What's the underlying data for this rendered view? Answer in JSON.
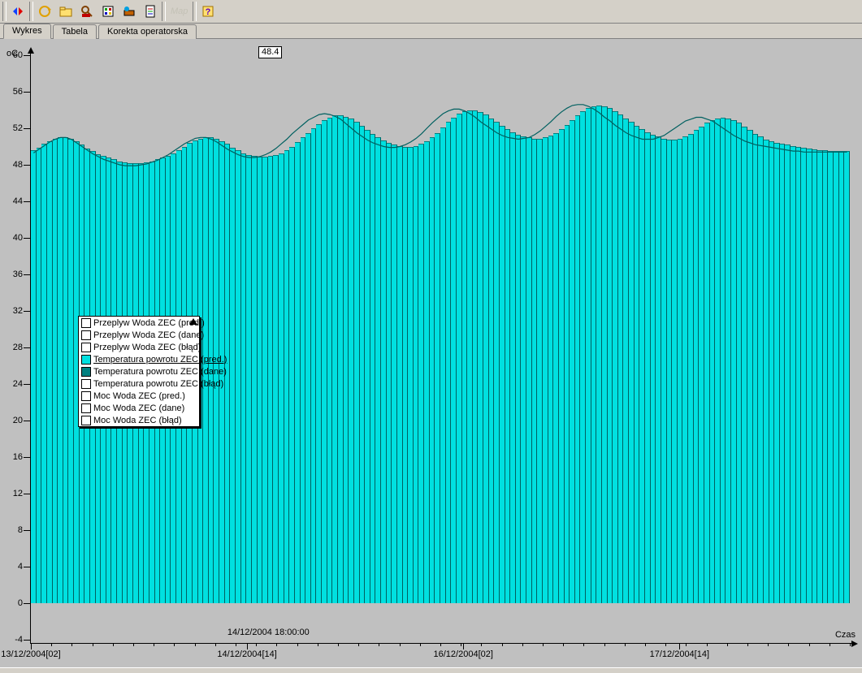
{
  "toolbar": {
    "buttons": [
      {
        "name": "nav-prevnext-icon"
      },
      {
        "name": "refresh-icon"
      },
      {
        "name": "folder-icon"
      },
      {
        "name": "find-icon"
      },
      {
        "name": "config-icon"
      },
      {
        "name": "tools-icon"
      },
      {
        "name": "properties-icon"
      },
      {
        "name": "map-icon",
        "disabled": true,
        "label": "Map"
      },
      {
        "name": "help-icon"
      }
    ]
  },
  "tabs": [
    {
      "id": "wykres",
      "label": "Wykres",
      "active": true
    },
    {
      "id": "tabela",
      "label": "Tabela",
      "active": false
    },
    {
      "id": "korekta",
      "label": "Korekta operatorska",
      "active": false
    }
  ],
  "tooltip_value": "48.4",
  "axes": {
    "y_title": "oC",
    "x_title": "Czas",
    "x_time_label": "14/12/2004 18:00:00"
  },
  "legend": {
    "items": [
      {
        "label": "Przeplyw Woda ZEC (pred.)",
        "color": "#ffffff"
      },
      {
        "label": "Przeplyw Woda ZEC (dane)",
        "color": "#ffffff"
      },
      {
        "label": "Przeplyw Woda ZEC (błąd)",
        "color": "#ffffff"
      },
      {
        "label": "Temperatura powrotu ZEC (pred.)",
        "color": "#00e0e0",
        "underline": true
      },
      {
        "label": "Temperatura powrotu ZEC (dane)",
        "color": "#008080"
      },
      {
        "label": "Temperatura powrotu ZEC (błąd)",
        "color": "#ffffff"
      },
      {
        "label": "Moc Woda ZEC (pred.)",
        "color": "#ffffff"
      },
      {
        "label": "Moc Woda ZEC (dane)",
        "color": "#ffffff"
      },
      {
        "label": "Moc Woda ZEC (błąd)",
        "color": "#ffffff"
      }
    ]
  },
  "chart_data": {
    "type": "bar",
    "title": "",
    "xlabel": "Czas",
    "ylabel": "oC",
    "ylim": [
      -4,
      60
    ],
    "y_ticks": [
      -4,
      0,
      4,
      8,
      12,
      16,
      20,
      24,
      28,
      32,
      36,
      40,
      44,
      48,
      52,
      56,
      60
    ],
    "x_tick_labels": [
      "13/12/2004[02]",
      "14/12/2004[14]",
      "16/12/2004[02]",
      "17/12/2004[14]"
    ],
    "x_tick_positions_frac": [
      0.0,
      0.264,
      0.528,
      0.792
    ],
    "series": [
      {
        "name": "Temperatura powrotu ZEC (pred.)",
        "type": "bar",
        "color": "#00e0e0",
        "values": [
          49.5,
          49.8,
          50.2,
          50.5,
          50.8,
          50.9,
          50.9,
          50.8,
          50.5,
          50.1,
          49.7,
          49.4,
          49.1,
          48.9,
          48.7,
          48.5,
          48.3,
          48.2,
          48.1,
          48.1,
          48.1,
          48.2,
          48.3,
          48.5,
          48.7,
          48.9,
          49.2,
          49.5,
          49.9,
          50.3,
          50.6,
          50.8,
          50.9,
          50.9,
          50.8,
          50.5,
          50.2,
          49.8,
          49.5,
          49.2,
          49.0,
          48.9,
          48.8,
          48.8,
          48.9,
          49.0,
          49.2,
          49.5,
          49.9,
          50.4,
          50.9,
          51.4,
          51.9,
          52.4,
          52.8,
          53.1,
          53.3,
          53.3,
          53.2,
          53.0,
          52.6,
          52.2,
          51.7,
          51.3,
          50.9,
          50.6,
          50.3,
          50.1,
          50.0,
          49.9,
          49.9,
          50.0,
          50.2,
          50.5,
          50.9,
          51.4,
          52.0,
          52.6,
          53.1,
          53.5,
          53.8,
          53.9,
          53.9,
          53.7,
          53.4,
          53.0,
          52.6,
          52.2,
          51.8,
          51.5,
          51.2,
          51.0,
          50.9,
          50.8,
          50.8,
          50.9,
          51.1,
          51.4,
          51.8,
          52.3,
          52.8,
          53.3,
          53.8,
          54.1,
          54.3,
          54.4,
          54.3,
          54.1,
          53.8,
          53.4,
          53.0,
          52.6,
          52.2,
          51.8,
          51.5,
          51.2,
          51.0,
          50.8,
          50.7,
          50.7,
          50.8,
          51.0,
          51.3,
          51.7,
          52.1,
          52.5,
          52.8,
          53.0,
          53.1,
          53.0,
          52.8,
          52.5,
          52.1,
          51.7,
          51.3,
          51.0,
          50.7,
          50.5,
          50.3,
          50.2,
          50.1,
          50.0,
          49.9,
          49.8,
          49.7,
          49.6,
          49.5,
          49.5,
          49.4,
          49.4,
          49.4,
          49.4
        ]
      },
      {
        "name": "Temperatura powrotu ZEC (dane)",
        "type": "line",
        "color": "#006060",
        "values": [
          49.3,
          49.7,
          50.1,
          50.5,
          50.8,
          51.0,
          51.0,
          50.8,
          50.4,
          50.0,
          49.6,
          49.2,
          48.9,
          48.6,
          48.4,
          48.2,
          48.0,
          47.9,
          47.9,
          47.9,
          48.0,
          48.1,
          48.3,
          48.5,
          48.8,
          49.1,
          49.5,
          49.9,
          50.3,
          50.6,
          50.9,
          51.0,
          51.0,
          50.8,
          50.5,
          50.1,
          49.7,
          49.4,
          49.1,
          48.9,
          48.8,
          48.8,
          48.9,
          49.1,
          49.4,
          49.8,
          50.3,
          50.8,
          51.4,
          51.9,
          52.4,
          52.9,
          53.2,
          53.5,
          53.6,
          53.5,
          53.3,
          53.0,
          52.5,
          52.0,
          51.5,
          51.1,
          50.7,
          50.4,
          50.2,
          50.0,
          49.9,
          49.9,
          50.0,
          50.2,
          50.5,
          50.9,
          51.4,
          52.0,
          52.6,
          53.1,
          53.6,
          53.9,
          54.1,
          54.1,
          53.9,
          53.6,
          53.2,
          52.7,
          52.3,
          51.9,
          51.5,
          51.2,
          51.0,
          50.9,
          50.8,
          50.9,
          51.0,
          51.3,
          51.7,
          52.2,
          52.7,
          53.3,
          53.8,
          54.2,
          54.5,
          54.6,
          54.6,
          54.4,
          54.1,
          53.7,
          53.2,
          52.8,
          52.3,
          51.9,
          51.5,
          51.2,
          51.0,
          50.8,
          50.8,
          50.8,
          51.0,
          51.2,
          51.6,
          52.0,
          52.4,
          52.8,
          53.0,
          53.2,
          53.2,
          53.0,
          52.8,
          52.4,
          52.0,
          51.6,
          51.2,
          50.9,
          50.6,
          50.4,
          50.2,
          50.1,
          50.0,
          49.9,
          49.8,
          49.7,
          49.6,
          49.5,
          49.5,
          49.4,
          49.4,
          49.4,
          49.4,
          49.4,
          49.4,
          49.4,
          49.4,
          49.4
        ]
      }
    ]
  }
}
